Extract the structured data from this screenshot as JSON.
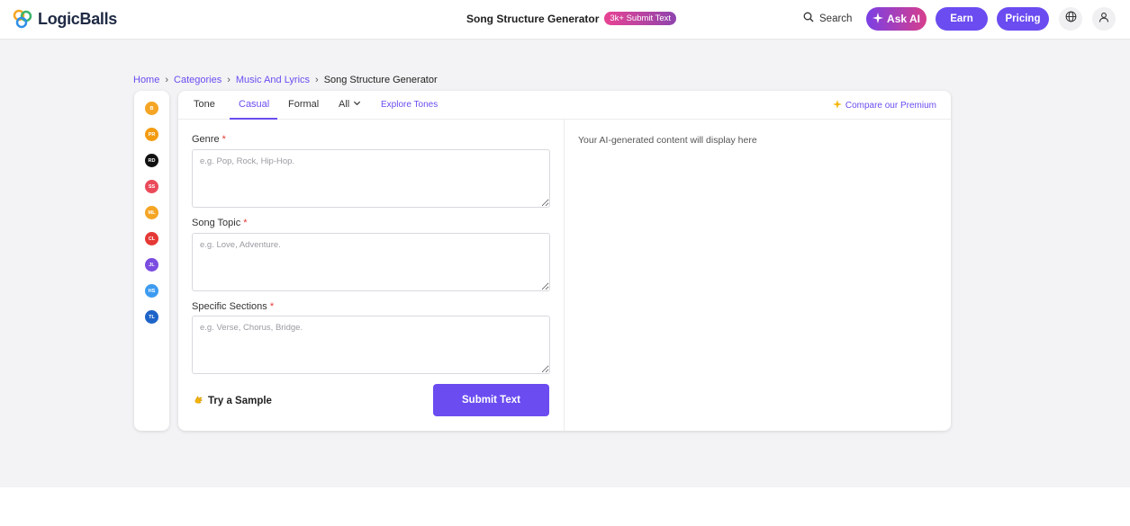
{
  "header": {
    "brand": "LogicBalls",
    "title": "Song Structure Generator",
    "badge": "3k+ Submit Text",
    "search_label": "Search",
    "ask_ai_label": "Ask AI",
    "earn_label": "Earn",
    "pricing_label": "Pricing",
    "icons": [
      "globe-icon",
      "user-icon",
      "search-icon",
      "sparkle-icon"
    ]
  },
  "breadcrumb": {
    "items": [
      "Home",
      "Categories",
      "Music And Lyrics"
    ],
    "current": "Song Structure Generator"
  },
  "sidebar": {
    "items": [
      {
        "initials": "B",
        "color": "#f5a524"
      },
      {
        "initials": "PR",
        "color": "#f39c12"
      },
      {
        "initials": "RD",
        "color": "#111111"
      },
      {
        "initials": "SS",
        "color": "#ea4a5a"
      },
      {
        "initials": "ML",
        "color": "#f5a524"
      },
      {
        "initials": "CL",
        "color": "#e53935"
      },
      {
        "initials": "JL",
        "color": "#7b4ce0"
      },
      {
        "initials": "HS",
        "color": "#3d9bf0"
      },
      {
        "initials": "TL",
        "color": "#1e64c8"
      }
    ]
  },
  "tabs": {
    "tone_label": "Tone",
    "casual_label": "Casual",
    "formal_label": "Formal",
    "all_label": "All",
    "explore_label": "Explore Tones",
    "compare_label": "Compare our Premium"
  },
  "form": {
    "genre_label": "Genre",
    "genre_placeholder": "e.g. Pop, Rock, Hip-Hop.",
    "topic_label": "Song Topic",
    "topic_placeholder": "e.g. Love, Adventure.",
    "sections_label": "Specific Sections",
    "sections_placeholder": "e.g. Verse, Chorus, Bridge.",
    "required_mark": "*",
    "sample_label": "Try a Sample",
    "submit_label": "Submit Text"
  },
  "output": {
    "placeholder": "Your AI-generated content will display here"
  },
  "colors": {
    "accent": "#6b4cf0",
    "required": "#e53935"
  }
}
